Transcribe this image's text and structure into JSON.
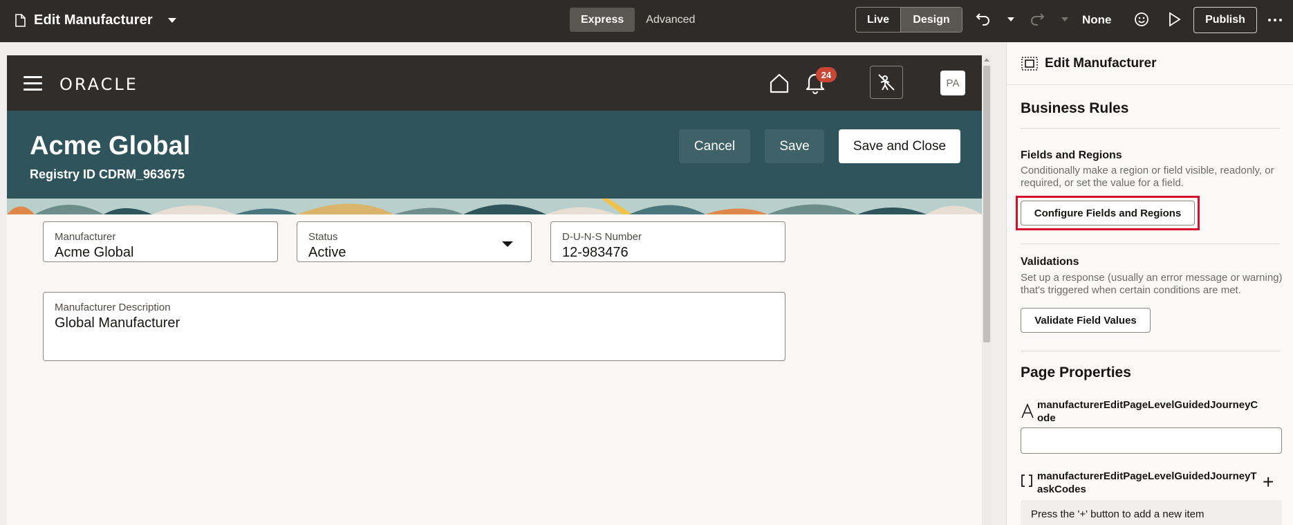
{
  "topbar": {
    "page_title": "Edit Manufacturer",
    "mode_express": "Express",
    "mode_advanced": "Advanced",
    "view_live": "Live",
    "view_design": "Design",
    "sandbox_label": "None",
    "publish_label": "Publish"
  },
  "app": {
    "brand": "ORACLE",
    "notification_count": "24",
    "avatar_initials": "PA"
  },
  "page_header": {
    "title": "Acme Global",
    "subtitle": "Registry ID CDRM_963675",
    "cancel_label": "Cancel",
    "save_label": "Save",
    "save_close_label": "Save and Close"
  },
  "form": {
    "manufacturer": {
      "label": "Manufacturer",
      "value": "Acme Global"
    },
    "status": {
      "label": "Status",
      "value": "Active"
    },
    "duns": {
      "label": "D-U-N-S Number",
      "value": "12-983476"
    },
    "description": {
      "label": "Manufacturer Description",
      "value": "Global Manufacturer"
    }
  },
  "panel": {
    "title": "Edit Manufacturer",
    "business_rules": "Business Rules",
    "fields_regions_title": "Fields and Regions",
    "fields_regions_desc": "Conditionally make a region or field visible, readonly, or required, or set the value for a field.",
    "configure_btn": "Configure Fields and Regions",
    "validations_title": "Validations",
    "validations_desc": "Set up a response (usually an error message or warning) that's triggered when certain conditions are met.",
    "validate_btn": "Validate Field Values",
    "page_properties": "Page Properties",
    "prop1_name": "manufacturerEditPageLevelGuidedJourneyCode",
    "prop2_name": "manufacturerEditPageLevelGuidedJourneyTaskCodes",
    "prop2_hint": "Press the '+' button to add a new item"
  },
  "colors": {
    "topbar": "#2e2b28",
    "app_header": "#312d2a",
    "page_header": "#2f545c",
    "highlight": "#d5112a",
    "badge": "#c74634"
  }
}
